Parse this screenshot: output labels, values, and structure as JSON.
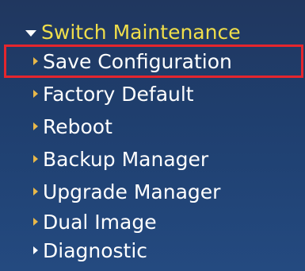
{
  "menu": {
    "section_title": "Switch Maintenance",
    "items": [
      {
        "label": "Save Configuration"
      },
      {
        "label": "Factory Default"
      },
      {
        "label": "Reboot"
      },
      {
        "label": "Backup Manager"
      },
      {
        "label": "Upgrade Manager"
      },
      {
        "label": "Dual Image"
      },
      {
        "label": "Diagnostic"
      }
    ]
  },
  "colors": {
    "section_title": "#f0de4a",
    "item_text": "#ffffff",
    "item_arrow": "#e8b84a",
    "highlight_border": "#e5262d",
    "panel_top": "#20375f",
    "panel_bottom": "#244a80"
  },
  "highlight": {
    "target": "Save Configuration"
  }
}
